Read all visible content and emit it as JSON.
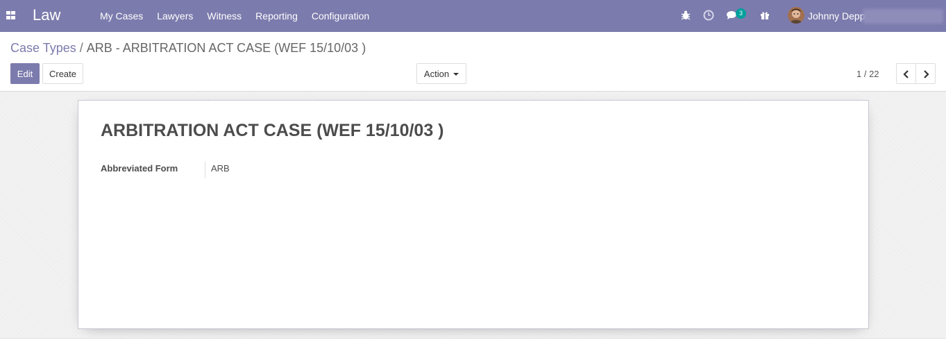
{
  "navbar": {
    "app_name": "Law",
    "menu": [
      {
        "label": "My Cases"
      },
      {
        "label": "Lawyers"
      },
      {
        "label": "Witness"
      },
      {
        "label": "Reporting"
      },
      {
        "label": "Configuration"
      }
    ],
    "icons": [
      "apps-icon",
      "bug-icon",
      "clock-icon",
      "chat-icon",
      "gift-icon"
    ],
    "chat_badge": "3",
    "user_name": "Johnny Depp",
    "colors": {
      "navbar_bg": "#7c7bad",
      "badge_bg": "#00a09d"
    }
  },
  "breadcrumb": {
    "parent": "Case Types",
    "separator": "/",
    "current": "ARB - ARBITRATION ACT CASE (WEF 15/10/03 )"
  },
  "toolbar": {
    "edit_label": "Edit",
    "create_label": "Create",
    "action_label": "Action",
    "pager_value": "1 / 22"
  },
  "form": {
    "title": "ARBITRATION ACT CASE (WEF 15/10/03 )",
    "fields": [
      {
        "label": "Abbreviated Form",
        "value": "ARB"
      }
    ]
  }
}
